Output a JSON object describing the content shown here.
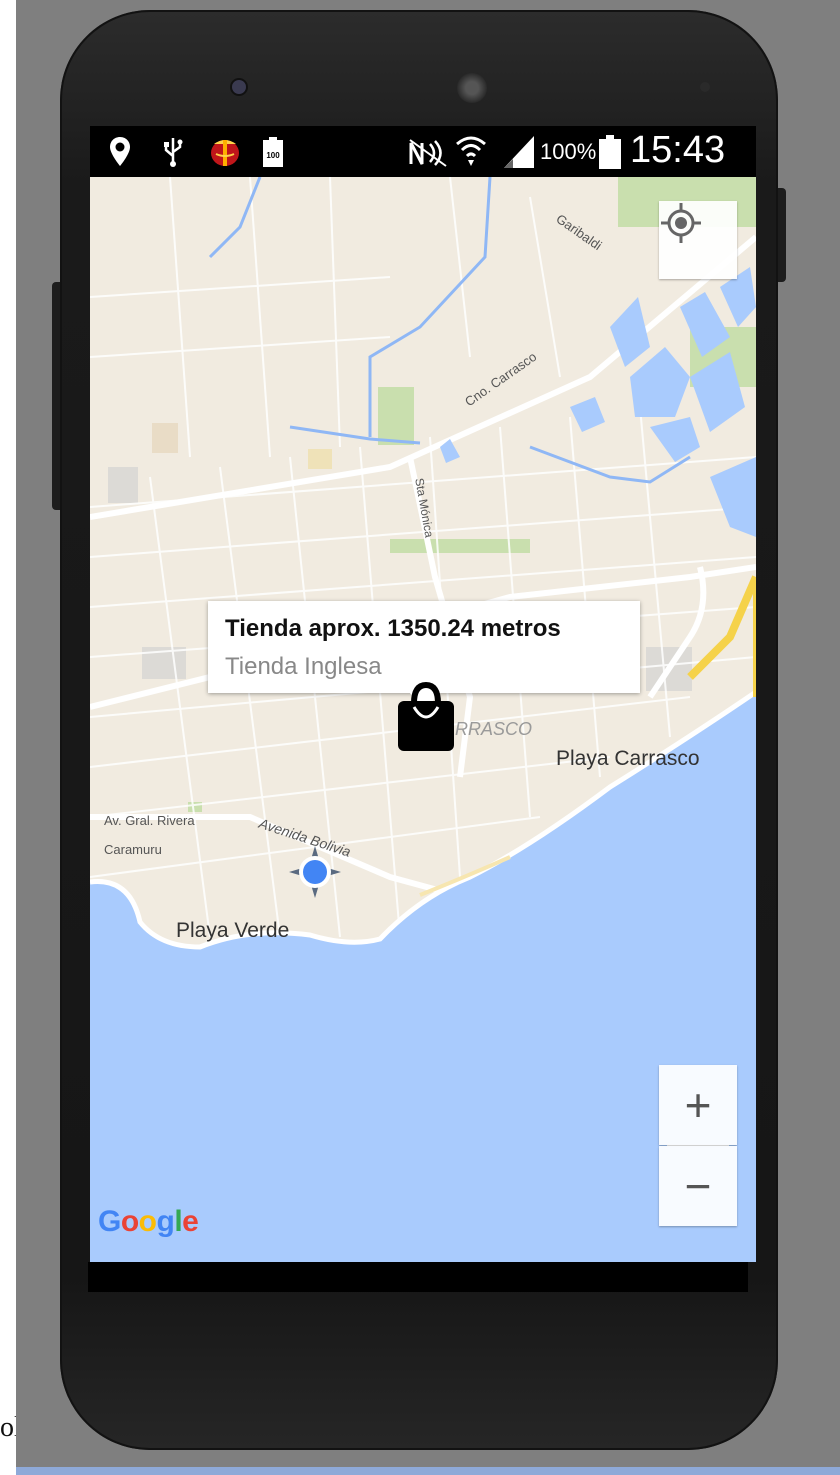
{
  "status_bar": {
    "battery_percent": "100%",
    "time": "15:43",
    "small_battery_label": "100",
    "icons": [
      "location-pin-icon",
      "usb-icon",
      "gift-icon",
      "battery-small-icon",
      "nfc-icon",
      "wifi-icon",
      "signal-icon",
      "battery-icon"
    ]
  },
  "map": {
    "labels": {
      "garibaldi": "Garibaldi",
      "cno_carrasco": "Cno. Carrasco",
      "sta_monica": "Sta Mónica",
      "carrasco": "RRASCO",
      "playa_carrasco": "Playa Carrasco",
      "av_gral_rivera": "Av. Gral. Rivera",
      "avenida_bolivia": "Avenida Bolivia",
      "caramuru": "Caramuru",
      "playa_verde": "Playa Verde"
    },
    "colors": {
      "land": "#f1ebe0",
      "water": "#a9cbfd",
      "park": "#c9dfae",
      "highway": "#f5d24a"
    }
  },
  "info_window": {
    "title": "Tienda aprox. 1350.24 metros",
    "snippet": "Tienda Inglesa"
  },
  "controls": {
    "my_location_icon": "crosshair-icon",
    "zoom_in_label": "+",
    "zoom_out_label": "−"
  },
  "branding": {
    "letters": [
      "G",
      "o",
      "o",
      "g",
      "l",
      "e"
    ],
    "colors": [
      "#4285f4",
      "#ea4335",
      "#fbbc05",
      "#4285f4",
      "#34a853",
      "#ea4335"
    ]
  },
  "page_fragment_text": "ol"
}
